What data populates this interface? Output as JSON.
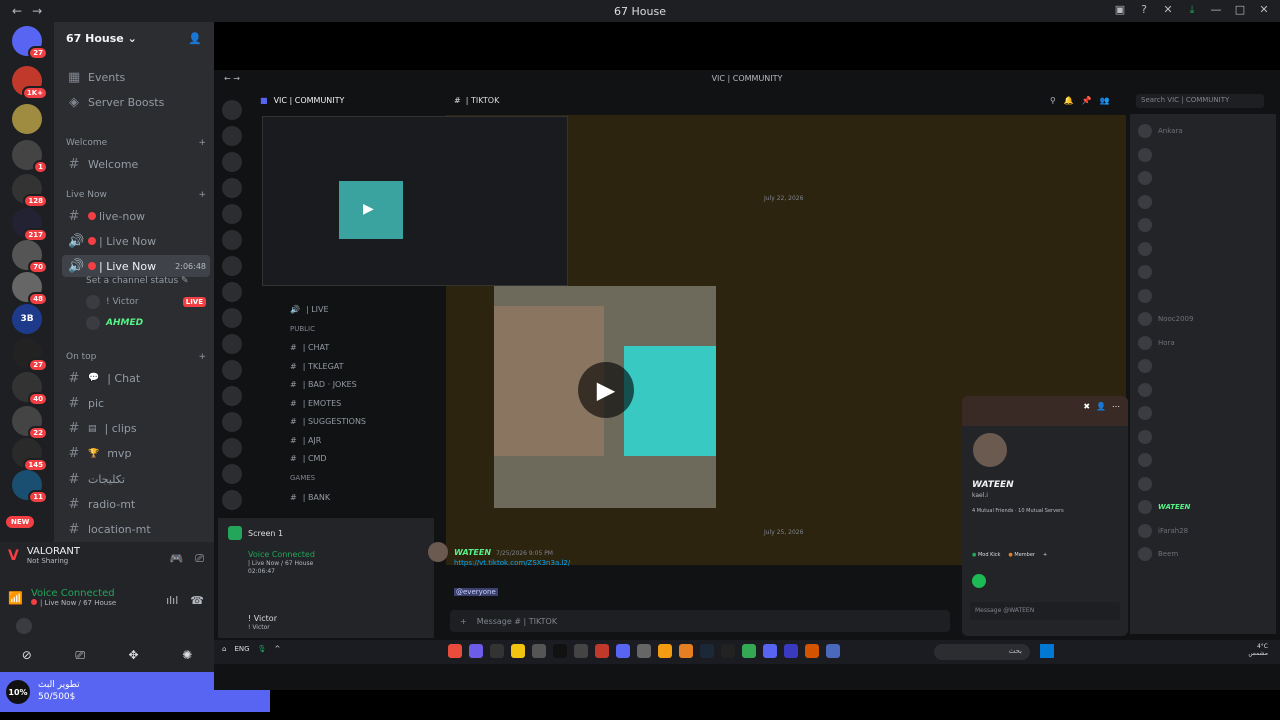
{
  "window": {
    "title": "67 House"
  },
  "server": {
    "name": "67 House"
  },
  "servers": {
    "items": [
      {
        "label": "",
        "badge": "27",
        "color": "#5865f2"
      },
      {
        "label": "",
        "badge": "1K+",
        "color": "#c0392b"
      },
      {
        "label": "",
        "badge": "",
        "color": "#a08c40"
      },
      {
        "label": "",
        "badge": "1",
        "color": "#444"
      },
      {
        "label": "",
        "badge": "128",
        "color": "#333"
      },
      {
        "label": "",
        "badge": "217",
        "color": "#223"
      },
      {
        "label": "",
        "badge": "70",
        "color": "#555"
      },
      {
        "label": "",
        "badge": "48",
        "color": "#666"
      },
      {
        "label": "3B",
        "badge": "",
        "color": "#1e3a8a"
      },
      {
        "label": "",
        "badge": "27",
        "color": "#222"
      },
      {
        "label": "",
        "badge": "40",
        "color": "#333"
      },
      {
        "label": "",
        "badge": "22",
        "color": "#444"
      },
      {
        "label": "",
        "badge": "145",
        "color": "#2a2a2a"
      },
      {
        "label": "",
        "badge": "11",
        "color": "#1b4f72"
      }
    ],
    "new_badge": "NEW"
  },
  "sidebar": {
    "top": [
      {
        "label": "Events"
      },
      {
        "label": "Server Boosts"
      }
    ],
    "categories": {
      "welcome": "Welcome",
      "live_now": "Live Now",
      "on_top": "On top"
    },
    "welcome_channel": "Welcome",
    "live_channels": [
      {
        "label": "live-now"
      },
      {
        "label": "| Live Now"
      },
      {
        "label": "| Live Now",
        "timer": "2:06:48"
      }
    ],
    "channel_status": "Set a channel status",
    "voice_users": [
      {
        "name": "! Victor",
        "tag": "LIVE"
      },
      {
        "name": "AHMED"
      }
    ],
    "on_top_channels": [
      {
        "label": "| Chat"
      },
      {
        "label": "pic"
      },
      {
        "label": "| clips"
      },
      {
        "label": "mvp"
      },
      {
        "label": "تكليجات"
      },
      {
        "label": "radio-mt"
      },
      {
        "label": "location-mt"
      }
    ]
  },
  "activity": {
    "game": "VALORANT",
    "status": "Not Sharing"
  },
  "voice": {
    "status": "Voice Connected",
    "channel": "| Live Now / 67 House"
  },
  "toast": {
    "percent": "10%",
    "title": "تطوير البث",
    "progress_text": "50/500$"
  },
  "inner": {
    "window_title": "VIC | COMMUNITY",
    "server_name": "VIC | COMMUNITY",
    "channel_title": "| TIKTOK",
    "search_placeholder": "Search VIC | COMMUNITY",
    "date1": "July 22, 2026",
    "date2": "July 25, 2026",
    "channels": [
      {
        "label": "| LIVE",
        "kind": "voice"
      },
      {
        "label": "PUBLIC",
        "kind": "cat"
      },
      {
        "label": "| CHAT",
        "kind": "text"
      },
      {
        "label": "| TKLEGAT",
        "kind": "text"
      },
      {
        "label": "| BAD · JOKES",
        "kind": "text"
      },
      {
        "label": "| EMOTES",
        "kind": "text"
      },
      {
        "label": "| SUGGESTIONS",
        "kind": "text"
      },
      {
        "label": "| AJR",
        "kind": "text"
      },
      {
        "label": "| CMD",
        "kind": "text"
      },
      {
        "label": "GAMES",
        "kind": "cat"
      },
      {
        "label": "| BANK",
        "kind": "text"
      }
    ],
    "screen_label": "Screen 1",
    "voice_status": "Voice Connected",
    "voice_channel": "| Live Now / 67 House",
    "voice_timer": "02:06:47",
    "user_name": "! Victor",
    "user_sub": "! Victor",
    "message": {
      "author": "WATEEN",
      "time": "7/25/2026 9:05 PM",
      "link": "https://vt.tiktok.com/ZSX3n3a.l2/",
      "mention": "@everyone"
    },
    "input_placeholder": "Message #   | TIKTOK",
    "profile": {
      "name": "WATEEN",
      "handle": "kael.i",
      "mutual": "4 Mutual Friends · 10 Mutual Servers",
      "roles": [
        "Mod Kick",
        "Member"
      ],
      "message_placeholder": "Message @WATEEN"
    },
    "members": [
      {
        "name": "Ankara"
      },
      {
        "name": ""
      },
      {
        "name": ""
      },
      {
        "name": ""
      },
      {
        "name": ""
      },
      {
        "name": ""
      },
      {
        "name": ""
      },
      {
        "name": ""
      },
      {
        "name": "Nooc2009"
      },
      {
        "name": "Hora"
      },
      {
        "name": ""
      },
      {
        "name": ""
      },
      {
        "name": ""
      },
      {
        "name": ""
      },
      {
        "name": ""
      },
      {
        "name": ""
      },
      {
        "name": "WATEEN",
        "highlight": true
      },
      {
        "name": "iFarah28"
      },
      {
        "name": "Beem"
      }
    ],
    "taskbar": {
      "lang": "ENG",
      "search": "بحث",
      "weather_temp": "4°C",
      "weather_desc": "مشمس"
    }
  }
}
